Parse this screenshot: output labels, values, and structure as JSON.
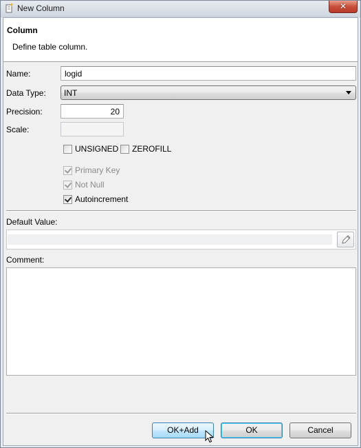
{
  "window": {
    "title": "New Column",
    "close_label": "✕"
  },
  "header": {
    "title": "Column",
    "description": "Define table column."
  },
  "form": {
    "name_label": "Name:",
    "name_value": "logid",
    "data_type_label": "Data Type:",
    "data_type_value": "INT",
    "precision_label": "Precision:",
    "precision_value": "20",
    "scale_label": "Scale:",
    "scale_value": "",
    "unsigned_label": "UNSIGNED",
    "zerofill_label": "ZEROFILL",
    "primary_key_label": "Primary Key",
    "not_null_label": "Not Null",
    "autoincrement_label": "Autoincrement",
    "default_value_label": "Default Value:",
    "comment_label": "Comment:"
  },
  "checkboxes": {
    "unsigned": false,
    "zerofill": false,
    "primary_key": true,
    "not_null": true,
    "autoincrement": true
  },
  "buttons": {
    "ok_add": "OK+Add",
    "ok": "OK",
    "cancel": "Cancel"
  },
  "colors": {
    "accent": "#3c7fb1",
    "close": "#c9503a"
  }
}
